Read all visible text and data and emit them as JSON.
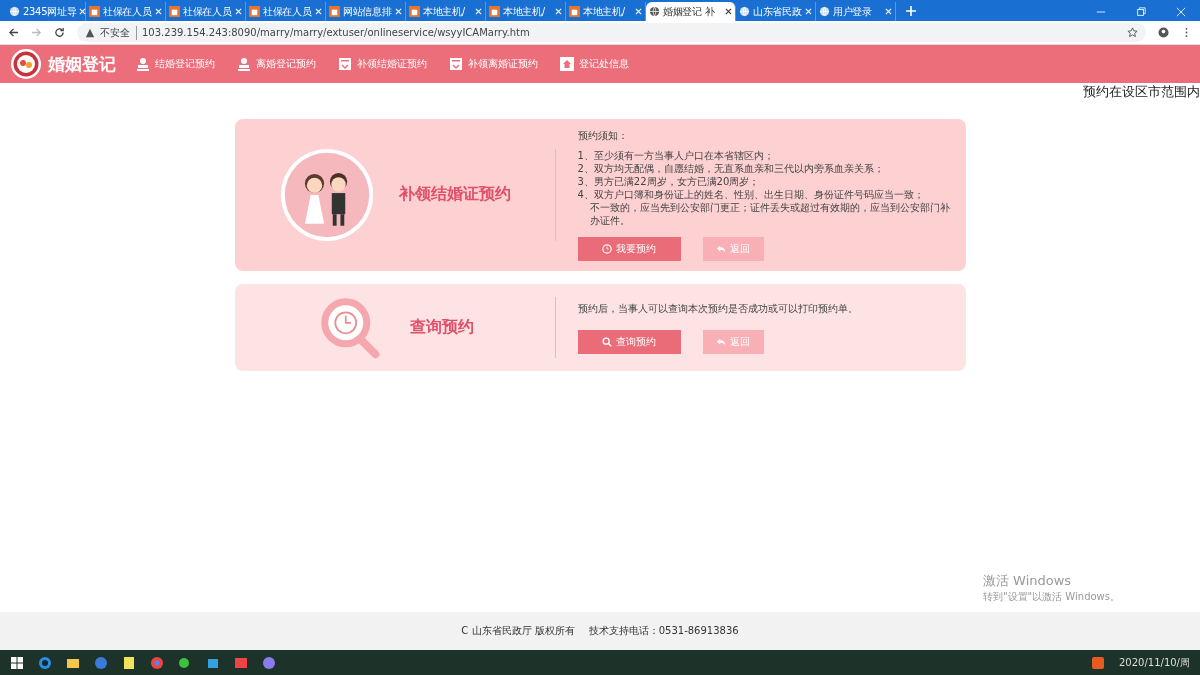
{
  "browser": {
    "tabs": [
      {
        "title": "2345网址导",
        "kind": "globe",
        "selected": false
      },
      {
        "title": "社保在人员",
        "kind": "site",
        "selected": false
      },
      {
        "title": "社保在人员",
        "kind": "site",
        "selected": false
      },
      {
        "title": "社保在人员",
        "kind": "site",
        "selected": false
      },
      {
        "title": "网站信息排",
        "kind": "site",
        "selected": false
      },
      {
        "title": "本地主机/",
        "kind": "site",
        "selected": false
      },
      {
        "title": "本地主机/",
        "kind": "site",
        "selected": false
      },
      {
        "title": "本地主机/",
        "kind": "site",
        "selected": false
      },
      {
        "title": "婚姻登记 补",
        "kind": "globe",
        "selected": true
      },
      {
        "title": "山东省民政",
        "kind": "globe",
        "selected": false
      },
      {
        "title": "用户登录",
        "kind": "globe",
        "selected": false
      }
    ],
    "security": "不安全",
    "url": "103.239.154.243:8090/marry/marry/extuser/onlineservice/wsyyICAMarry.htm"
  },
  "site": {
    "logo_text": "婚姻登记",
    "nav": [
      {
        "label": "结婚登记预约",
        "kind": "person"
      },
      {
        "label": "离婚登记预约",
        "kind": "person"
      },
      {
        "label": "补领结婚证预约",
        "kind": "cert"
      },
      {
        "label": "补领离婚证预约",
        "kind": "cert"
      },
      {
        "label": "登记处信息",
        "kind": "home"
      }
    ],
    "overflow_text": "预约在设区市范围内"
  },
  "cards": [
    {
      "kind": "notice",
      "title": "补领结婚证预约",
      "heading": "预约须知：",
      "items": [
        "1、至少须有一方当事人户口在本省辖区内；",
        "2、双方均无配偶，自愿结婚，无直系血亲和三代以内旁系血亲关系；",
        "3、男方已满22周岁，女方已满20周岁；",
        "4、双方户口簿和身份证上的姓名、性别、出生日期、身份证件号码应当一致；",
        "不一致的，应当先到公安部门更正；证件丢失或超过有效期的，应当到公安部门补办证件。"
      ],
      "buttons": [
        {
          "label": "我要预约",
          "kind": "primary"
        },
        {
          "label": "返回",
          "kind": "secondary"
        }
      ]
    },
    {
      "kind": "query",
      "title": "查询预约",
      "text": "预约后，当事人可以查询本次预约是否成功或可以打印预约单。",
      "buttons": [
        {
          "label": "查询预约",
          "kind": "primary"
        },
        {
          "label": "返回",
          "kind": "secondary"
        }
      ]
    }
  ],
  "footer": {
    "copyright": "C 山东省民政厅 版权所有",
    "phone": "技术支持电话：0531-86913836"
  },
  "activation": {
    "title": "激活 Windows",
    "subtitle": "转到\"设置\"以激活 Windows。"
  },
  "taskbar": {
    "clock": "2020/11/10/周"
  }
}
